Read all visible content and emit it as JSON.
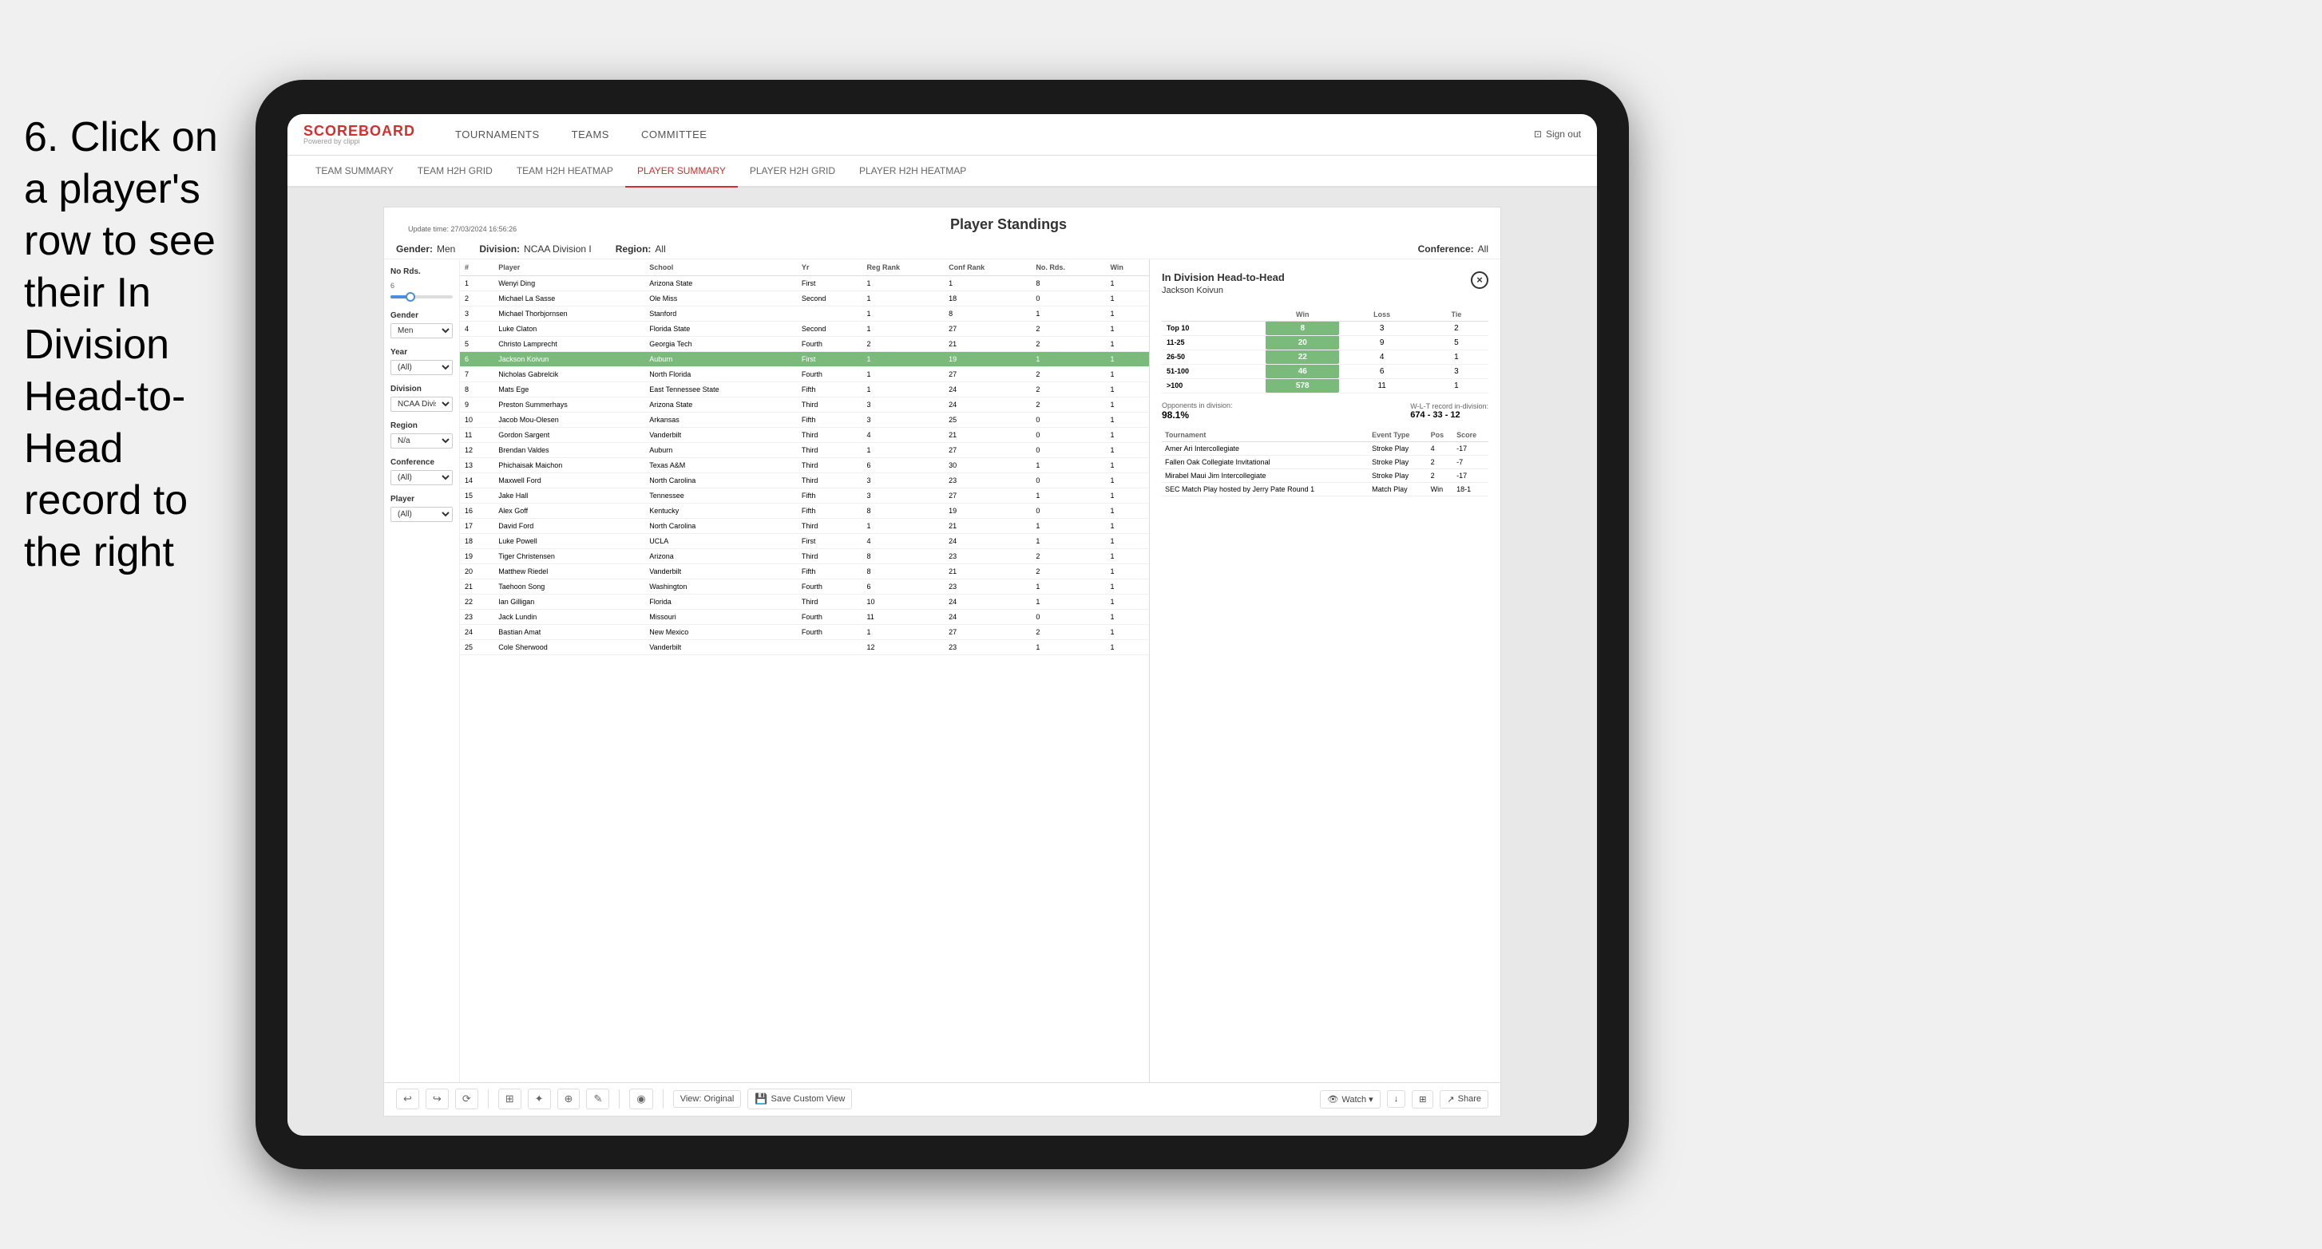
{
  "instruction": {
    "text": "6. Click on a player's row to see their In Division Head-to-Head record to the right"
  },
  "nav": {
    "logo_main": "SCOREBOARD",
    "logo_sub": "Powered by clippi",
    "items": [
      "TOURNAMENTS",
      "TEAMS",
      "COMMITTEE"
    ],
    "sign_out": "Sign out"
  },
  "sub_nav": {
    "items": [
      "TEAM SUMMARY",
      "TEAM H2H GRID",
      "TEAM H2H HEATMAP",
      "PLAYER SUMMARY",
      "PLAYER H2H GRID",
      "PLAYER H2H HEATMAP"
    ],
    "active": "PLAYER SUMMARY"
  },
  "card": {
    "update_time": "Update time: 27/03/2024 16:56:26",
    "title": "Player Standings",
    "filters": {
      "gender": "Men",
      "division": "NCAA Division I",
      "region": "All",
      "conference": "All"
    }
  },
  "left_filters": {
    "no_rds_label": "No Rds.",
    "no_rds_value": "6",
    "gender_label": "Gender",
    "gender_value": "Men",
    "year_label": "Year",
    "year_value": "(All)",
    "division_label": "Division",
    "division_value": "NCAA Division I",
    "region_label": "Region",
    "region_value": "N/a",
    "conference_label": "Conference",
    "conference_value": "(All)",
    "player_label": "Player",
    "player_value": "(All)"
  },
  "table": {
    "headers": [
      "#",
      "Player",
      "School",
      "Yr",
      "Reg Rank",
      "Conf Rank",
      "No. Rds.",
      "Win"
    ],
    "rows": [
      {
        "rank": 1,
        "player": "Wenyi Ding",
        "school": "Arizona State",
        "yr": "First",
        "reg": 1,
        "conf": 1,
        "rds": 8,
        "win": 1,
        "selected": false
      },
      {
        "rank": 2,
        "player": "Michael La Sasse",
        "school": "Ole Miss",
        "yr": "Second",
        "reg": 1,
        "conf": 18,
        "rds": 0,
        "win": 1,
        "selected": false
      },
      {
        "rank": 3,
        "player": "Michael Thorbjornsen",
        "school": "Stanford",
        "yr": "",
        "reg": 1,
        "conf": 8,
        "rds": 1,
        "win": 1,
        "selected": false
      },
      {
        "rank": 4,
        "player": "Luke Claton",
        "school": "Florida State",
        "yr": "Second",
        "reg": 1,
        "conf": 27,
        "rds": 2,
        "win": 1,
        "selected": false
      },
      {
        "rank": 5,
        "player": "Christo Lamprecht",
        "school": "Georgia Tech",
        "yr": "Fourth",
        "reg": 2,
        "conf": 21,
        "rds": 2,
        "win": 1,
        "selected": false
      },
      {
        "rank": 6,
        "player": "Jackson Koivun",
        "school": "Auburn",
        "yr": "First",
        "reg": 1,
        "conf": 19,
        "rds": 1,
        "win": 1,
        "selected": true
      },
      {
        "rank": 7,
        "player": "Nicholas Gabrelcik",
        "school": "North Florida",
        "yr": "Fourth",
        "reg": 1,
        "conf": 27,
        "rds": 2,
        "win": 1,
        "selected": false
      },
      {
        "rank": 8,
        "player": "Mats Ege",
        "school": "East Tennessee State",
        "yr": "Fifth",
        "reg": 1,
        "conf": 24,
        "rds": 2,
        "win": 1,
        "selected": false
      },
      {
        "rank": 9,
        "player": "Preston Summerhays",
        "school": "Arizona State",
        "yr": "Third",
        "reg": 3,
        "conf": 24,
        "rds": 2,
        "win": 1,
        "selected": false
      },
      {
        "rank": 10,
        "player": "Jacob Mou-Olesen",
        "school": "Arkansas",
        "yr": "Fifth",
        "reg": 3,
        "conf": 25,
        "rds": 0,
        "win": 1,
        "selected": false
      },
      {
        "rank": 11,
        "player": "Gordon Sargent",
        "school": "Vanderbilt",
        "yr": "Third",
        "reg": 4,
        "conf": 21,
        "rds": 0,
        "win": 1,
        "selected": false
      },
      {
        "rank": 12,
        "player": "Brendan Valdes",
        "school": "Auburn",
        "yr": "Third",
        "reg": 1,
        "conf": 27,
        "rds": 0,
        "win": 1,
        "selected": false
      },
      {
        "rank": 13,
        "player": "Phichaisak Maichon",
        "school": "Texas A&M",
        "yr": "Third",
        "reg": 6,
        "conf": 30,
        "rds": 1,
        "win": 1,
        "selected": false
      },
      {
        "rank": 14,
        "player": "Maxwell Ford",
        "school": "North Carolina",
        "yr": "Third",
        "reg": 3,
        "conf": 23,
        "rds": 0,
        "win": 1,
        "selected": false
      },
      {
        "rank": 15,
        "player": "Jake Hall",
        "school": "Tennessee",
        "yr": "Fifth",
        "reg": 3,
        "conf": 27,
        "rds": 1,
        "win": 1,
        "selected": false
      },
      {
        "rank": 16,
        "player": "Alex Goff",
        "school": "Kentucky",
        "yr": "Fifth",
        "reg": 8,
        "conf": 19,
        "rds": 0,
        "win": 1,
        "selected": false
      },
      {
        "rank": 17,
        "player": "David Ford",
        "school": "North Carolina",
        "yr": "Third",
        "reg": 1,
        "conf": 21,
        "rds": 1,
        "win": 1,
        "selected": false
      },
      {
        "rank": 18,
        "player": "Luke Powell",
        "school": "UCLA",
        "yr": "First",
        "reg": 4,
        "conf": 24,
        "rds": 1,
        "win": 1,
        "selected": false
      },
      {
        "rank": 19,
        "player": "Tiger Christensen",
        "school": "Arizona",
        "yr": "Third",
        "reg": 8,
        "conf": 23,
        "rds": 2,
        "win": 1,
        "selected": false
      },
      {
        "rank": 20,
        "player": "Matthew Riedel",
        "school": "Vanderbilt",
        "yr": "Fifth",
        "reg": 8,
        "conf": 21,
        "rds": 2,
        "win": 1,
        "selected": false
      },
      {
        "rank": 21,
        "player": "Taehoon Song",
        "school": "Washington",
        "yr": "Fourth",
        "reg": 6,
        "conf": 23,
        "rds": 1,
        "win": 1,
        "selected": false
      },
      {
        "rank": 22,
        "player": "Ian Gilligan",
        "school": "Florida",
        "yr": "Third",
        "reg": 10,
        "conf": 24,
        "rds": 1,
        "win": 1,
        "selected": false
      },
      {
        "rank": 23,
        "player": "Jack Lundin",
        "school": "Missouri",
        "yr": "Fourth",
        "reg": 11,
        "conf": 24,
        "rds": 0,
        "win": 1,
        "selected": false
      },
      {
        "rank": 24,
        "player": "Bastian Amat",
        "school": "New Mexico",
        "yr": "Fourth",
        "reg": 1,
        "conf": 27,
        "rds": 2,
        "win": 1,
        "selected": false
      },
      {
        "rank": 25,
        "player": "Cole Sherwood",
        "school": "Vanderbilt",
        "yr": "",
        "reg": 12,
        "conf": 23,
        "rds": 1,
        "win": 1,
        "selected": false
      }
    ]
  },
  "h2h": {
    "title": "In Division Head-to-Head",
    "player": "Jackson Koivun",
    "close_btn": "×",
    "table_headers": [
      "",
      "Win",
      "Loss",
      "Tie"
    ],
    "rows": [
      {
        "rank": "Top 10",
        "win": 8,
        "loss": 3,
        "tie": 2
      },
      {
        "rank": "11-25",
        "win": 20,
        "loss": 9,
        "tie": 5
      },
      {
        "rank": "26-50",
        "win": 22,
        "loss": 4,
        "tie": 1
      },
      {
        "rank": "51-100",
        "win": 46,
        "loss": 6,
        "tie": 3
      },
      {
        "rank": ">100",
        "win": 578,
        "loss": 11,
        "tie": 1
      }
    ],
    "opponents_label": "Opponents in division:",
    "wlt_label": "W-L-T record in-division:",
    "pct": "98.1%",
    "record": "674 - 33 - 12",
    "tournaments": {
      "headers": [
        "Tournament",
        "Event Type",
        "Pos",
        "Score"
      ],
      "rows": [
        {
          "tournament": "Amer Ari Intercollegiate",
          "event_type": "Stroke Play",
          "pos": 4,
          "score": "-17"
        },
        {
          "tournament": "Fallen Oak Collegiate Invitational",
          "event_type": "Stroke Play",
          "pos": 2,
          "score": "-7"
        },
        {
          "tournament": "Mirabel Maui Jim Intercollegiate",
          "event_type": "Stroke Play",
          "pos": 2,
          "score": "-17"
        },
        {
          "tournament": "SEC Match Play hosted by Jerry Pate Round 1",
          "event_type": "Match Play",
          "pos": "Win",
          "score": "18-1"
        }
      ]
    }
  },
  "toolbar": {
    "buttons": [
      "↩",
      "↪",
      "⟳",
      "⊞",
      "✦",
      "⊕",
      "✎",
      "◉",
      "View: Original",
      "Save Custom View"
    ],
    "right_buttons": [
      "👁 Watch ▾",
      "↓",
      "⊞",
      "Share"
    ]
  }
}
